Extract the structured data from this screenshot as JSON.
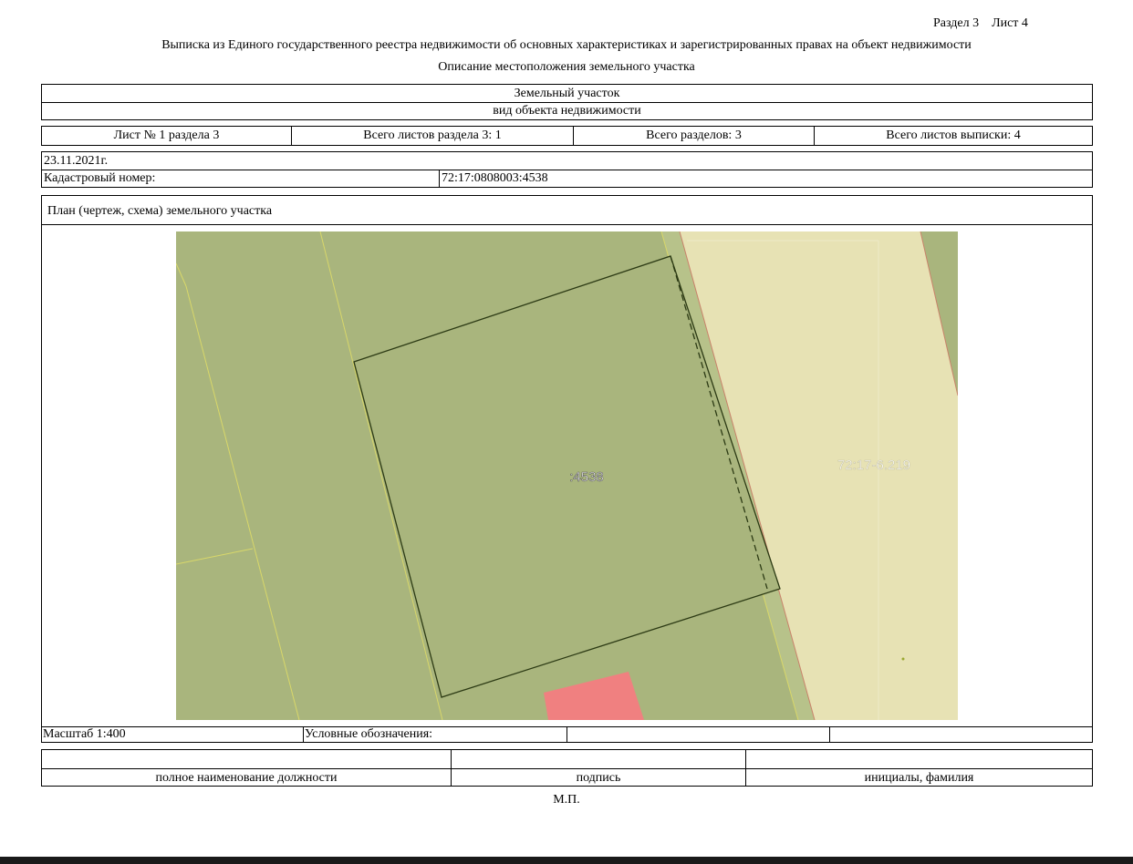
{
  "header": {
    "section_sheet": "Раздел 3    Лист 4",
    "title": "Выписка из Единого государственного реестра недвижимости об основных характеристиках и зарегистрированных правах на объект недвижимости",
    "subtitle": "Описание местоположения земельного участка"
  },
  "object": {
    "type_value": "Земельный участок",
    "type_label": "вид объекта недвижимости"
  },
  "sheets": {
    "sheet": "Лист № 1 раздела 3",
    "total_section_sheets": "Всего листов раздела 3: 1",
    "total_sections": "Всего разделов: 3",
    "total_extract_sheets": "Всего листов выписки: 4"
  },
  "info": {
    "date": "23.11.2021г.",
    "cadastral_label": "Кадастровый номер:",
    "cadastral_value": "72:17:0808003:4538"
  },
  "plan": {
    "title": "План (чертеж, схема) земельного участка",
    "parcel_label": ":4538",
    "neighbor_label": "72:17-6.219",
    "colors": {
      "parcel_fill": "#a9b57d",
      "neighbor_fill": "#e7e2b4",
      "building_fill": "#f08080",
      "boundary": "#2c3a14"
    }
  },
  "footer": {
    "scale": "Масштаб 1:400",
    "legend": "Условные обозначения:",
    "position_label": "полное наименование должности",
    "signature_label": "подпись",
    "name_label": "инициалы, фамилия",
    "stamp": "М.П."
  }
}
